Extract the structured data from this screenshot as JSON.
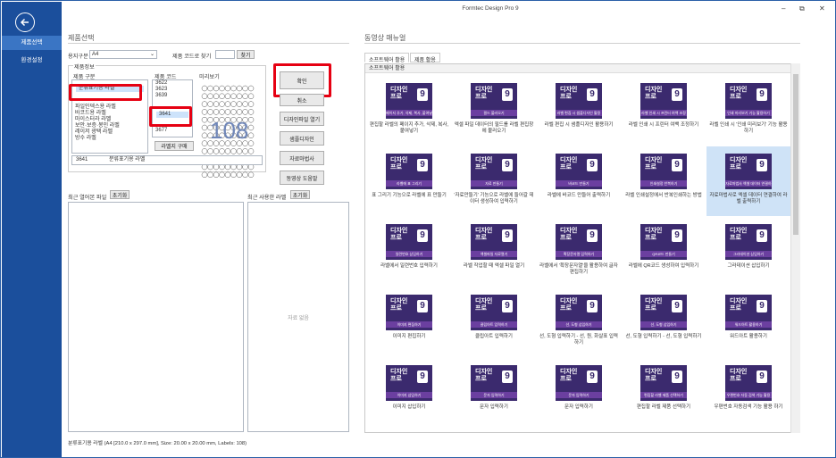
{
  "window": {
    "title": "Formtec Design Pro 9"
  },
  "sidebar": {
    "items": [
      {
        "label": "제품선택"
      },
      {
        "label": "환경설정"
      }
    ]
  },
  "left": {
    "title": "제품선택",
    "paper_label": "용지구분",
    "paper_value": "A4",
    "code_search_label": "제품 코드로 찾기",
    "find_btn": "찾기",
    "info_label": "제품정보",
    "type_label": "제품 구분",
    "code_label": "제품 코드",
    "preview_label": "미리보기",
    "types": [
      "분류표기용 라벨",
      "",
      "",
      "",
      "파일인덱스용 라벨",
      "바코드용 라벨",
      "마이스터라 라벨",
      "보안·보증·봉인 라벨",
      "레이저 광택 라벨",
      "방수 라벨"
    ],
    "codes_top": [
      "3622",
      "3623",
      "3639"
    ],
    "code_selected": "3641",
    "code_bottom": "3677",
    "buy_btn": "라벨지 구매",
    "preview_number": "108",
    "summary_code": "3641",
    "summary_name": "분류표기용 라벨",
    "buttons": {
      "confirm": "확인",
      "cancel": "취소",
      "open": "디자인파일 열기",
      "sample": "샘플디자인",
      "data": "자료마법사",
      "video": "동영상 도움말"
    },
    "recent_files": "최근 열어본 파일",
    "reset": "초기화",
    "recent_labels": "최근 사용한 라벨",
    "no_data": "자료 없음",
    "status": "분류표기용 라벨 (A4 [210.0 x 297.0 mm], Size: 20.00 x 20.00 mm, Labels: 108)"
  },
  "right": {
    "title": "동영상 매뉴얼",
    "tabs": [
      "소프트웨어 활용",
      "제품 활용"
    ],
    "section": "소프트웨어 활용",
    "thumb_title": "디자인\n프로",
    "videos": [
      {
        "tag": "페이지\n추가, 삭제, 복사, 붙여넣기",
        "cap": "편집할 라벨의 페이지 추가, 삭제, 복사, 붙여넣기"
      },
      {
        "tag": "필드 불러오기",
        "cap": "엑셀 파일 데이터의 필드를 라벨 편집창에 불러오기"
      },
      {
        "tag": "라벨 편집 시 샘플디자인 활용하기",
        "cap": "라벨 편집 시 샘플디자인 활용하기"
      },
      {
        "tag": "라벨 인쇄 시 프린터 여백 조정하기",
        "cap": "라벨 인쇄 시 프린터 여백 조정하기"
      },
      {
        "tag": "인쇄 미리보기 기능 활용하기",
        "cap": "라벨 인쇄 시 '인쇄 미리보기' 기능 활용하기"
      },
      {
        "tag": "라벨에 표 그리기",
        "cap": "표 그리기 기능으로 라벨에 표 만들기"
      },
      {
        "tag": "자료 만들기",
        "cap": "'자료만들기' 기능으로 라벨에 들어갈 데이터 생성하여 입력하기"
      },
      {
        "tag": "바코드 만들기",
        "cap": "라벨에 바코드 만들어 출력하기"
      },
      {
        "tag": "인쇄설정 반복하기",
        "cap": "라벨 인쇄설정에서 반복인쇄하는 방법"
      },
      {
        "tag": "자료마법사 엑셀 데이터 연결하기",
        "cap": "자료마법사로 엑셀 데이터 연결하여 라벨 출력하기"
      },
      {
        "tag": "일련번호 삽입하기",
        "cap": "라벨에서 일련번호 입력하기"
      },
      {
        "tag": "엑셀파일 자료열기",
        "cap": "라벨 작업할 때 엑셀 파일 열기"
      },
      {
        "tag": "확장문자열 입력하기",
        "cap": "라벨에서 '확장문자열'을 활용하여 글자 편집하기"
      },
      {
        "tag": "QR코드 만들기",
        "cap": "라벨에 QR코드 생성하여 입력하기"
      },
      {
        "tag": "그라데이션 삽입하기",
        "cap": "그라데이션 삽입하기"
      },
      {
        "tag": "이미지 편집하기",
        "cap": "이미지 편집하기"
      },
      {
        "tag": "클립아트 입력하기",
        "cap": "클립아트 입력하기"
      },
      {
        "tag": "선, 도형 삽입하기",
        "cap": "선, 도형 입력하기 - 선, 원, 화살표 입력하기"
      },
      {
        "tag": "선, 도형 삽입하기",
        "cap": "선, 도형 입력하기 - 선, 도형 입력하기"
      },
      {
        "tag": "워드아트 활용하기",
        "cap": "워드아트 활용하기"
      },
      {
        "tag": "이미지 삽입하기",
        "cap": "이미지 삽입하기"
      },
      {
        "tag": "문자 입력하기",
        "cap": "문자 입력하기"
      },
      {
        "tag": "문자 입력하기",
        "cap": "문자 입력하기"
      },
      {
        "tag": "편집할 라벨 제품 선택하기",
        "cap": "편집할 라벨 제품 선택하기"
      },
      {
        "tag": "우편번호 자동 검색 기능 활용하기",
        "cap": "우편번호 자동검색 기능 활용 하기"
      }
    ]
  }
}
